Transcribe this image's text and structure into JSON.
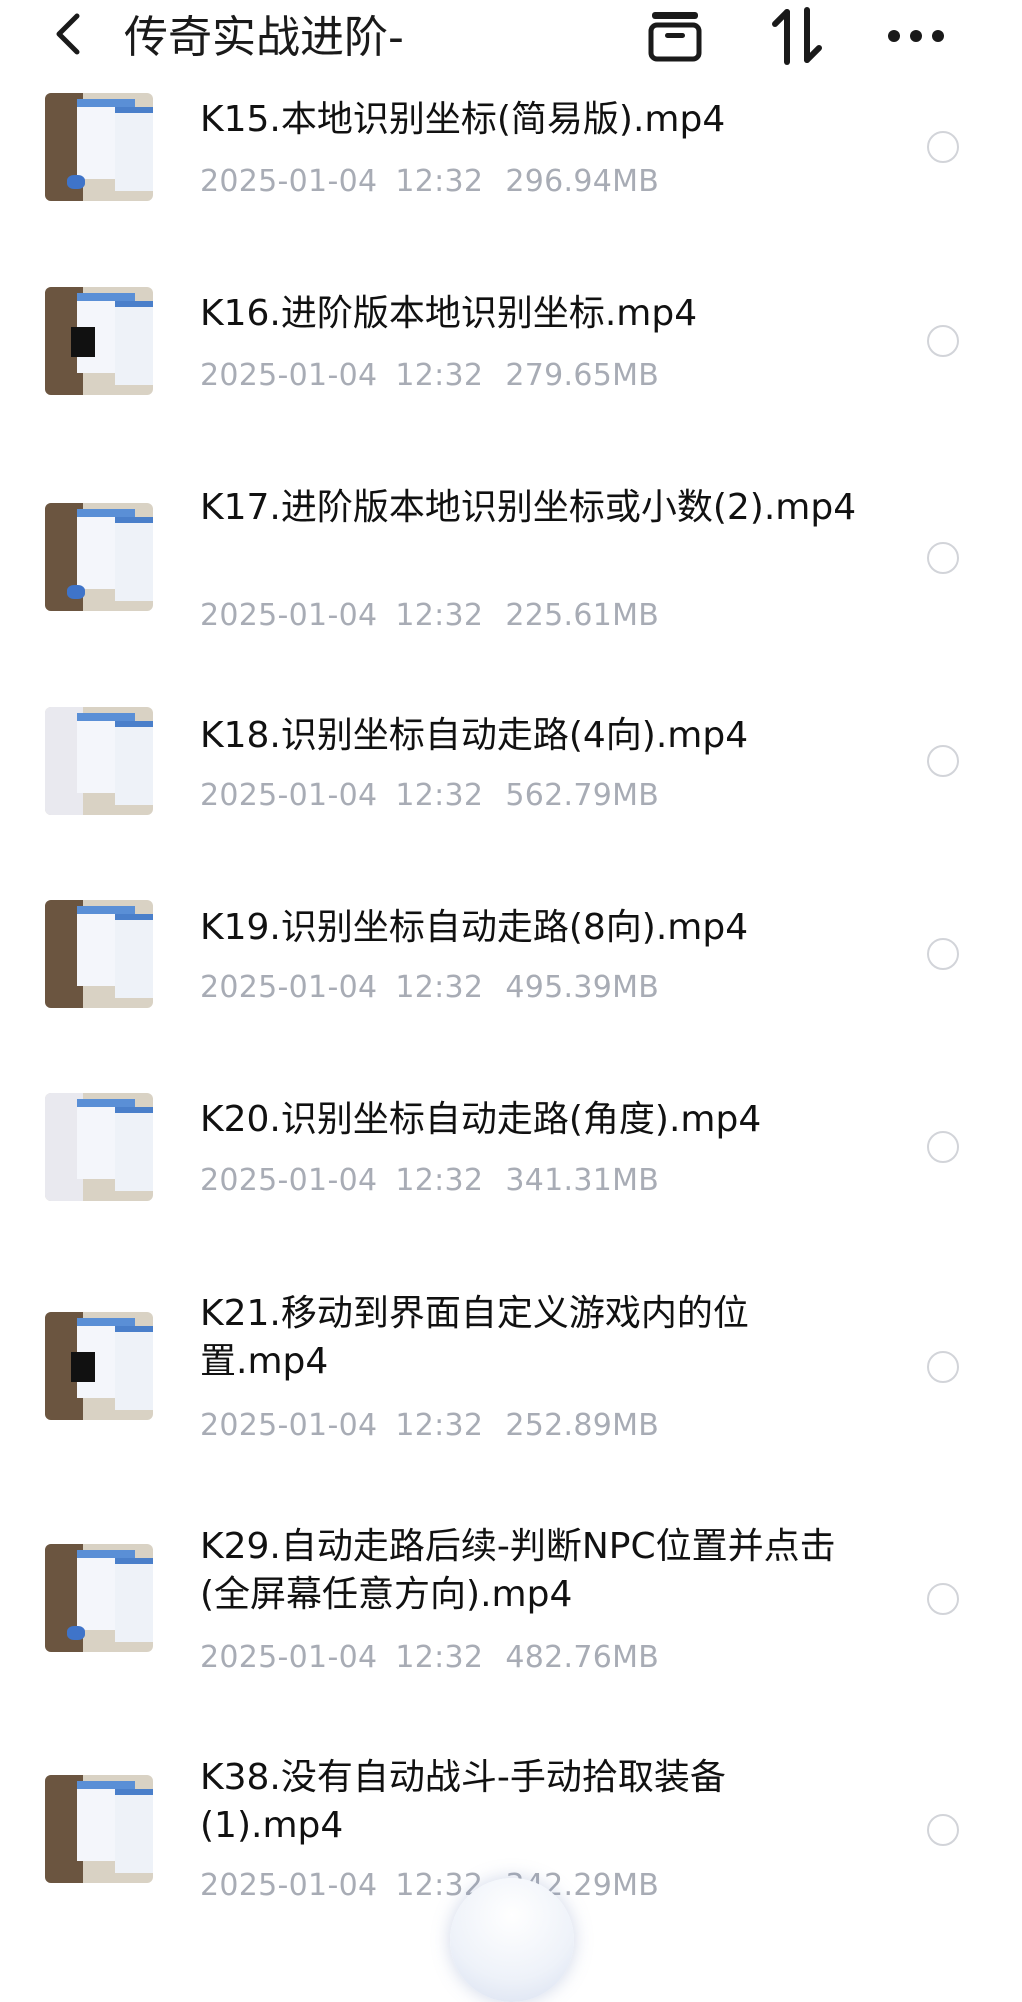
{
  "header": {
    "title": "传奇实战进阶-",
    "back_icon": "chevron-left-icon",
    "archive_icon": "archive-box-icon",
    "sort_icon": "sort-arrows-icon",
    "more_icon": "more-dots-icon"
  },
  "files": [
    {
      "name": "K15.本地识别坐标(简易版).mp4",
      "date": "2025-01-04",
      "time": "12:32",
      "size": "296.94MB"
    },
    {
      "name": "K16.进阶版本地识别坐标.mp4",
      "date": "2025-01-04",
      "time": "12:32",
      "size": "279.65MB"
    },
    {
      "name": "K17.进阶版本地识别坐标或小数(2).mp4",
      "date": "2025-01-04",
      "time": "12:32",
      "size": "225.61MB"
    },
    {
      "name": "K18.识别坐标自动走路(4向).mp4",
      "date": "2025-01-04",
      "time": "12:32",
      "size": "562.79MB"
    },
    {
      "name": "K19.识别坐标自动走路(8向).mp4",
      "date": "2025-01-04",
      "time": "12:32",
      "size": "495.39MB"
    },
    {
      "name": "K20.识别坐标自动走路(角度).mp4",
      "date": "2025-01-04",
      "time": "12:32",
      "size": "341.31MB"
    },
    {
      "name": "K21.移动到界面自定义游戏内的位置.mp4",
      "date": "2025-01-04",
      "time": "12:32",
      "size": "252.89MB"
    },
    {
      "name": "K29.自动走路后续-判断NPC位置并点击(全屏幕任意方向).mp4",
      "date": "2025-01-04",
      "time": "12:32",
      "size": "482.76MB"
    },
    {
      "name": "K38.没有自动战斗-手动拾取装备(1).mp4",
      "date": "2025-01-04",
      "time": "12:32",
      "size": "342.29MB"
    }
  ],
  "colors": {
    "title_text": "#1a1a1a",
    "meta_text": "#a8acb5",
    "radio_border": "#d2d4d9"
  }
}
